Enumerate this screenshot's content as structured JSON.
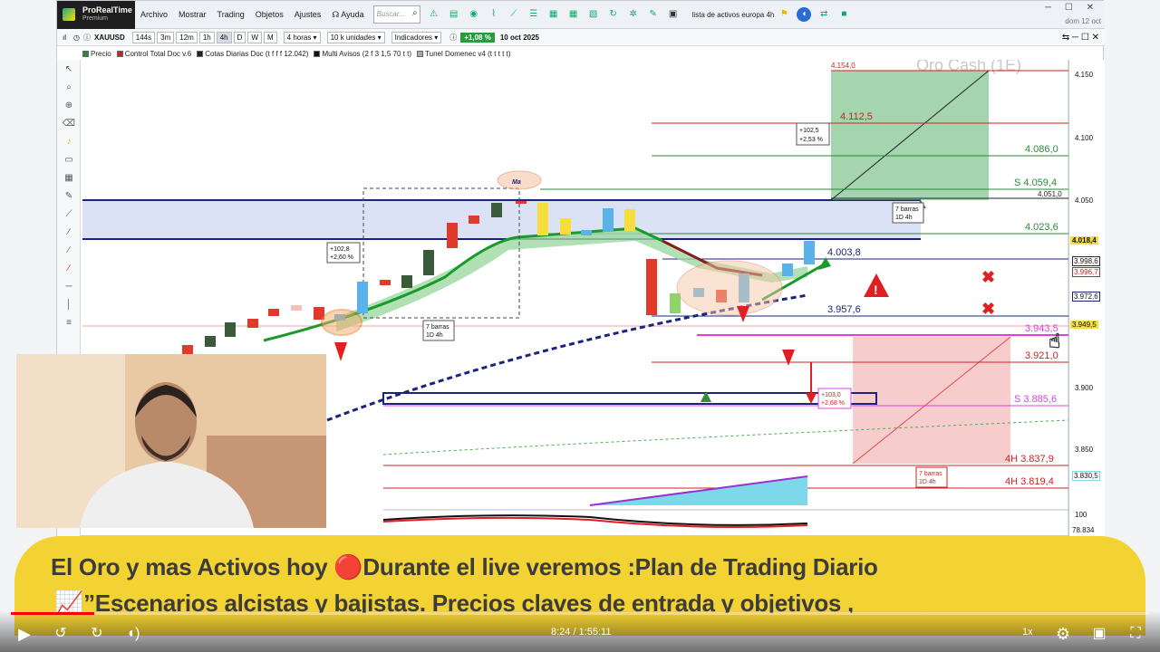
{
  "app": {
    "brand": "ProRealTime",
    "brand_sub": "Premium",
    "menu": [
      "Archivo",
      "Mostrar",
      "Trading",
      "Objetos",
      "Ajustes",
      "Ayuda"
    ],
    "search_placeholder": "Buscar...",
    "watchlist": "lista de activos europa 4h",
    "date_top": "dom 12 oct"
  },
  "chartbar": {
    "symbol": "XAUUSD",
    "timeframes": [
      "144s",
      "3m",
      "12m",
      "1h",
      "4h",
      "D",
      "W",
      "M"
    ],
    "active_tf": "4h",
    "period": "4 horas",
    "units": "10 k unidades",
    "indicators": "Indicadores",
    "change": "+1,08 %",
    "date": "10 oct 2025"
  },
  "legend": {
    "items": [
      "Precio",
      "Control Total Doc v.6",
      "Cotas Diarias Doc (t f f f 12.042)",
      "Multi Avisos (2 f 3 1,5 70 t t)",
      "Tunel Domenec v4 (t t t t t)"
    ]
  },
  "chart_data": {
    "type": "candlestick",
    "title": "Oro Cash (1E)",
    "price_ticks": [
      "4.150",
      "4.100",
      "4.050",
      "3.900",
      "3.850"
    ],
    "price_tags": [
      "4.018,4",
      "3.998,6",
      "3.996,7",
      "3.972,6",
      "3.949,5",
      "3.830,5",
      "100",
      "78.834"
    ],
    "levels": [
      {
        "label": "4.154,0",
        "color": "#cc2222"
      },
      {
        "label": "4.112,5",
        "color": "#cc2222"
      },
      {
        "label": "4.086,0",
        "color": "#2a8a3a"
      },
      {
        "label": "S 4.059,4",
        "color": "#2a8a3a"
      },
      {
        "label": "4.051,0",
        "color": "#222222"
      },
      {
        "label": "4.023,6",
        "color": "#2a8a3a"
      },
      {
        "label": "4.003,8",
        "color": "#1a237e"
      },
      {
        "label": "3.957,6",
        "color": "#1a237e"
      },
      {
        "label": "3.943,5",
        "color": "#e040e0"
      },
      {
        "label": "3.921,0",
        "color": "#cc2222"
      },
      {
        "label": "S 3.885,6",
        "color": "#e040e0"
      },
      {
        "label": "4H 3.837,9",
        "color": "#cc2222"
      },
      {
        "label": "4H 3.819,4",
        "color": "#cc2222"
      }
    ],
    "annotations": [
      "+102,8",
      "+2,60 %",
      "+102,5",
      "+2,53 %",
      "+103,0",
      "+2,68 %",
      "7 barras",
      "1D 4h",
      "Ma"
    ]
  },
  "video": {
    "caption_line1": "El Oro y mas Activos hoy 🔴Durante el live veremos :Plan de Trading Diario",
    "caption_line2": "📈”Escenarios alcistas y bajistas. Precios claves de entrada y objetivos ,",
    "timecode": "8:24 / 1:55:11",
    "speed": "1x",
    "progress": 0.073
  }
}
